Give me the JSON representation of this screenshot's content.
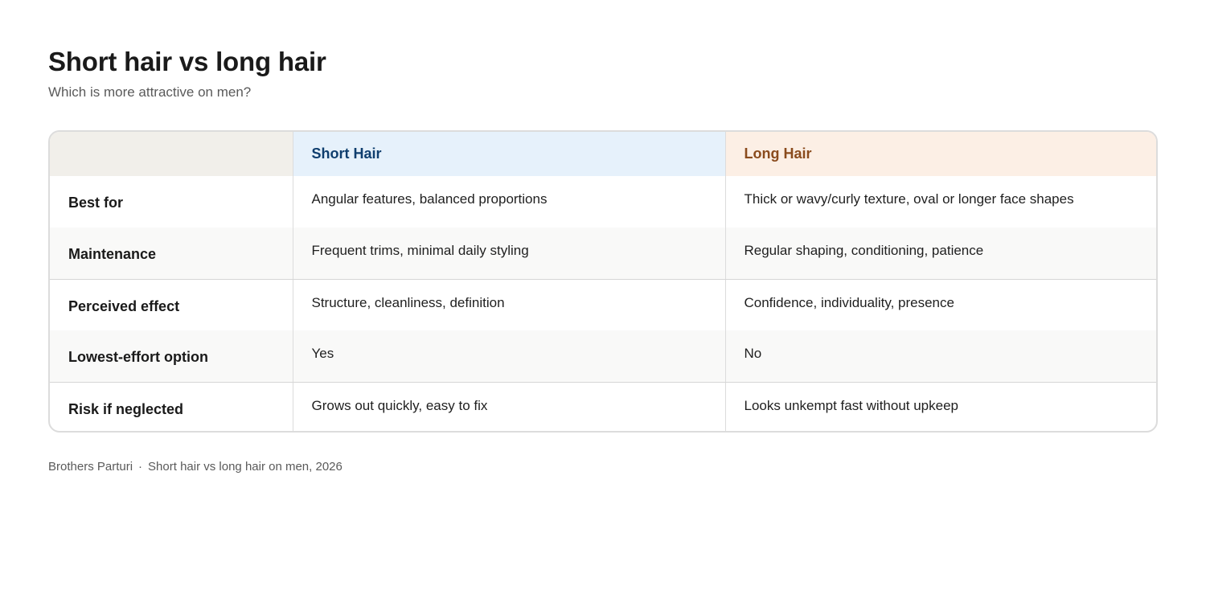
{
  "header": {
    "title": "Short hair vs long hair",
    "subtitle": "Which is more attractive on men?"
  },
  "table": {
    "columns": [
      "",
      "Short Hair",
      "Long Hair"
    ],
    "rows": [
      {
        "label": "Best for",
        "short": "Angular features, balanced proportions",
        "long": "Thick or wavy/curly texture, oval or longer face shapes"
      },
      {
        "label": "Maintenance",
        "short": "Frequent trims, minimal daily styling",
        "long": "Regular shaping, conditioning, patience"
      },
      {
        "label": "Perceived effect",
        "short": "Structure, cleanliness, definition",
        "long": "Confidence, individuality, presence"
      },
      {
        "label": "Lowest-effort option",
        "short": "Yes",
        "long": "No"
      },
      {
        "label": "Risk if neglected",
        "short": "Grows out quickly, easy to fix",
        "long": "Looks unkempt fast without upkeep"
      }
    ]
  },
  "footer": {
    "brand": "Brothers Parturi",
    "separator": "·",
    "caption": "Short hair vs long hair on men, 2026"
  },
  "colors": {
    "short_header_bg": "#e6f1fb",
    "short_header_text": "#0f3e6e",
    "long_header_bg": "#fcefe5",
    "long_header_text": "#8a4b1d"
  }
}
